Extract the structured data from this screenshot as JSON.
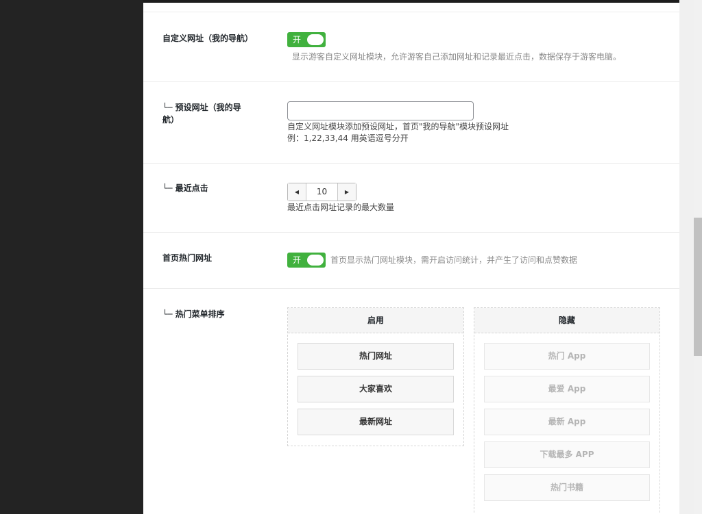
{
  "settings": {
    "custom_nav": {
      "label": "自定义网址（我的导航）",
      "switch_text": "开",
      "description": "显示游客自定义网址模块，允许游客自己添加网址和记录最近点击，数据保存于游客电脑。"
    },
    "preset_urls": {
      "label_line1": "└─ 预设网址（我的导",
      "label_line2": "航）",
      "value": "",
      "description_line1": "自定义网址模块添加预设网址，首页\"我的导航\"模块预设网址",
      "description_line2": "例：1,22,33,44 用英语逗号分开"
    },
    "recent_clicks": {
      "label": "└─ 最近点击",
      "value": "10",
      "description": "最近点击网址记录的最大数量"
    },
    "hot_urls": {
      "label": "首页热门网址",
      "switch_text": "开",
      "description": "首页显示热门网址模块，需开启访问统计，并产生了访问和点赞数据"
    },
    "hot_menu_sort": {
      "label": "└─ 热门菜单排序",
      "enabled_title": "启用",
      "hidden_title": "隐藏",
      "enabled_items": [
        "热门网址",
        "大家喜欢",
        "最新网址"
      ],
      "hidden_items": [
        "热门 App",
        "最爱 App",
        "最新 App",
        "下载最多 APP",
        "热门书籍"
      ]
    }
  },
  "colors": {
    "switch_on": "#41b13e",
    "left_panel": "#232323"
  },
  "icons": {
    "stepper_decrement": "triangle-left",
    "stepper_increment": "triangle-right"
  }
}
